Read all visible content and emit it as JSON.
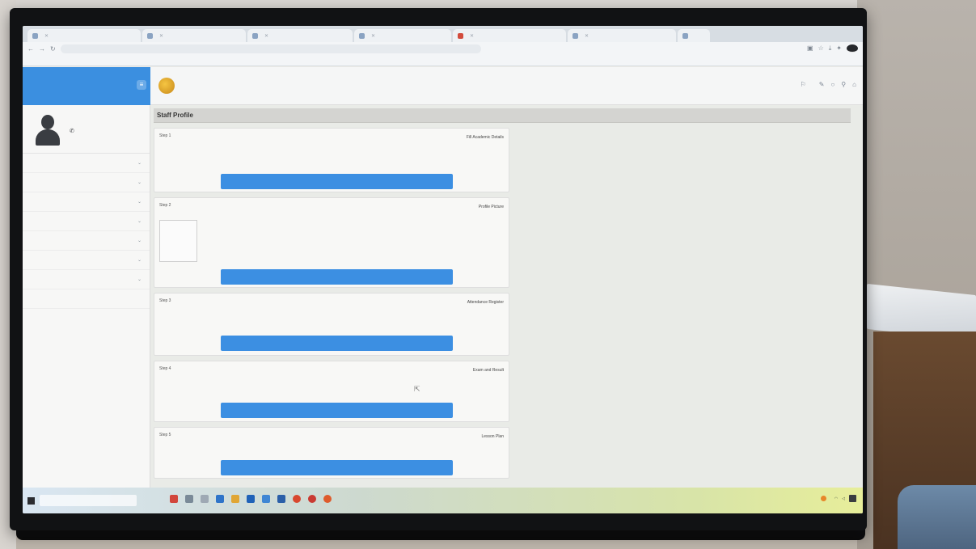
{
  "browser": {
    "tabs": [
      {
        "label": ""
      },
      {
        "label": ""
      },
      {
        "label": ""
      },
      {
        "label": ""
      },
      {
        "label": ""
      },
      {
        "label": ""
      },
      {
        "label": ""
      }
    ],
    "address": "",
    "bookmarks": [
      "",
      "",
      "",
      ""
    ]
  },
  "sidebar": {
    "header_name": "",
    "header_sub": "",
    "menu_glyph": "≡",
    "user_name": "",
    "user_dept": "",
    "menu": [
      {
        "label": ""
      },
      {
        "label": ""
      },
      {
        "label": ""
      },
      {
        "label": ""
      },
      {
        "label": ""
      },
      {
        "label": ""
      },
      {
        "label": ""
      },
      {
        "label": ""
      }
    ]
  },
  "header": {
    "college_name": "",
    "user_label": ""
  },
  "page": {
    "title": "Staff Profile",
    "cards": [
      {
        "step": "Step 1",
        "title": "Fill Academic Details",
        "desc_lines": [
          "",
          ""
        ],
        "button": ""
      },
      {
        "step": "Step 2",
        "title": "Profile Picture",
        "desc_lines": [
          ""
        ],
        "button": ""
      },
      {
        "step": "Step 3",
        "title": "Attendance Register",
        "desc_lines": [
          "",
          ""
        ],
        "button": ""
      },
      {
        "step": "Step 4",
        "title": "Exam and Result",
        "desc_lines": [
          "",
          ""
        ],
        "button": ""
      },
      {
        "step": "Step 5",
        "title": "Lesson Plan",
        "desc_lines": [
          ""
        ],
        "button": ""
      }
    ]
  },
  "taskbar": {
    "search_placeholder": "",
    "tray_text": ""
  },
  "colors": {
    "primary": "#3c8fe2",
    "sidebar_header": "#3b8fe0"
  }
}
